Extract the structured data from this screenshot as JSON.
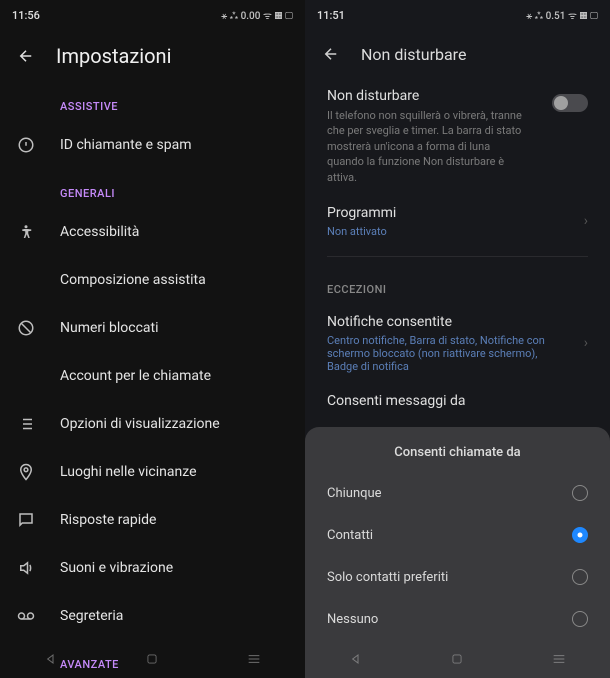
{
  "left": {
    "status": {
      "time": "11:56",
      "icons": "⚹ ⁂ 0.00 ᯤ ▦ ▢"
    },
    "title": "Impostazioni",
    "sections": {
      "assistive": {
        "header": "ASSISTIVE",
        "items": [
          "ID chiamante e spam"
        ]
      },
      "generali": {
        "header": "GENERALI",
        "items": [
          "Accessibilità",
          "Composizione assistita",
          "Numeri bloccati",
          "Account per le chiamate",
          "Opzioni di visualizzazione",
          "Luoghi nelle vicinanze",
          "Risposte rapide",
          "Suoni e vibrazione",
          "Segreteria"
        ]
      },
      "avanzate": {
        "header": "AVANZATE"
      }
    }
  },
  "right": {
    "status": {
      "time": "11:51",
      "icons": "⚹ ⁂ 0.51 ᯤ ▦ ▢"
    },
    "title": "Non disturbare",
    "dnd": {
      "title": "Non disturbare",
      "desc": "Il telefono non squillerà o vibrerà, tranne che per sveglia e timer. La barra di stato mostrerà un'icona a forma di luna quando la funzione Non disturbare è attiva."
    },
    "programmi": {
      "title": "Programmi",
      "sub": "Non attivato"
    },
    "eccezioni": {
      "header": "ECCEZIONI",
      "notifiche": {
        "title": "Notifiche consentite",
        "sub": "Centro notifiche, Barra di stato, Notifiche con schermo bloccato (non riattivare schermo), Badge di notifica"
      },
      "messaggi": {
        "title": "Consenti messaggi da"
      }
    },
    "sheet": {
      "title": "Consenti chiamate da",
      "options": [
        "Chiunque",
        "Contatti",
        "Solo contatti preferiti",
        "Nessuno"
      ],
      "selectedIndex": 1
    }
  }
}
